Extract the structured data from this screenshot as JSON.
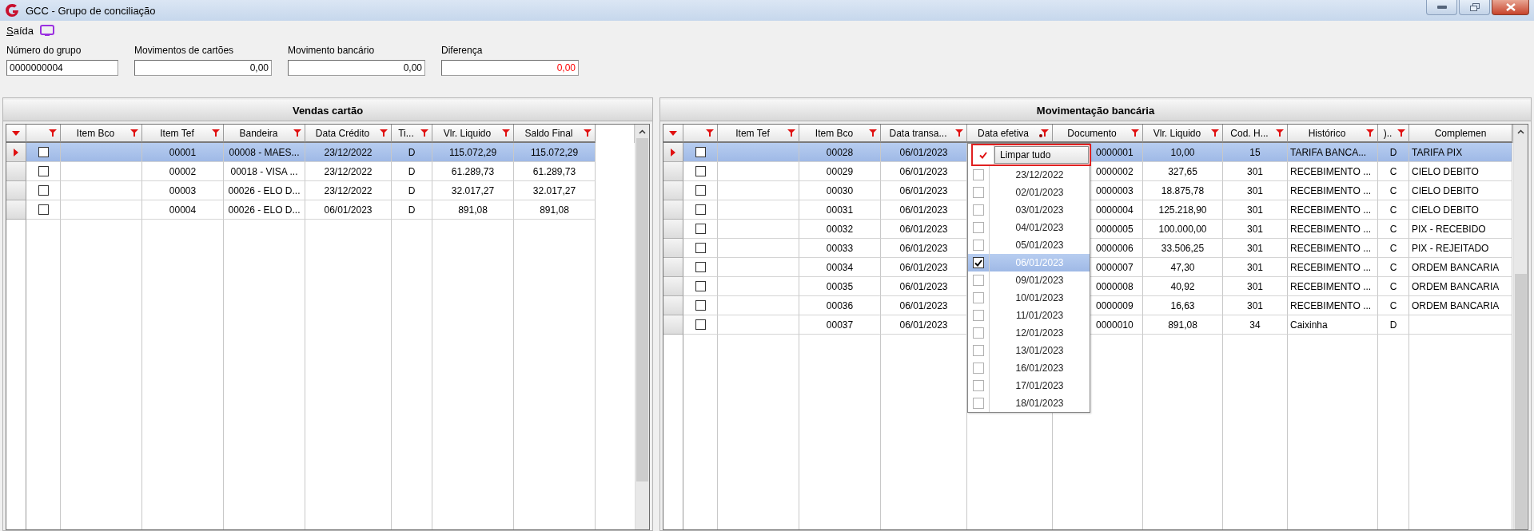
{
  "window": {
    "title": "GCC - Grupo de conciliação"
  },
  "menu": [
    {
      "label": "Saída"
    }
  ],
  "fields": [
    {
      "label": "Número do grupo",
      "value": "0000000004",
      "kind": "text",
      "alert": false
    },
    {
      "label": "Movimentos de cartões",
      "value": "0,00",
      "kind": "number",
      "alert": false
    },
    {
      "label": "Movimento bancário",
      "value": "0,00",
      "kind": "number",
      "alert": false
    },
    {
      "label": "Diferença",
      "value": "0,00",
      "kind": "number",
      "alert": true
    }
  ],
  "panels": [
    {
      "title": "Vendas cartão",
      "check_column": {
        "filter": true
      },
      "columns": [
        {
          "label": "Item Bco",
          "filter": true,
          "filter_active": false
        },
        {
          "label": "Item Tef",
          "filter": true,
          "filter_active": false
        },
        {
          "label": "Bandeira",
          "filter": true,
          "filter_active": false
        },
        {
          "label": "Data Crédito",
          "filter": true,
          "filter_active": false
        },
        {
          "label": "Ti...",
          "filter": true,
          "filter_active": false
        },
        {
          "label": "Vlr. Liquido",
          "filter": true,
          "filter_active": false
        },
        {
          "label": "Saldo Final",
          "filter": true,
          "filter_active": false
        }
      ],
      "rows": [
        {
          "selected": true,
          "checked": false,
          "cells": [
            null,
            "00001",
            "00008 - MAES...",
            "23/12/2022",
            "D",
            "115.072,29",
            "115.072,29"
          ]
        },
        {
          "selected": false,
          "checked": false,
          "cells": [
            null,
            "00002",
            "00018 - VISA ...",
            "23/12/2022",
            "D",
            "61.289,73",
            "61.289,73"
          ]
        },
        {
          "selected": false,
          "checked": false,
          "cells": [
            null,
            "00003",
            "00026 - ELO D...",
            "23/12/2022",
            "D",
            "32.017,27",
            "32.017,27"
          ]
        },
        {
          "selected": false,
          "checked": false,
          "cells": [
            null,
            "00004",
            "00026 - ELO D...",
            "06/01/2023",
            "D",
            "891,08",
            "891,08"
          ]
        }
      ]
    },
    {
      "title": "Movimentação bancária",
      "check_column": {
        "filter": true
      },
      "columns": [
        {
          "label": "Item Tef",
          "filter": true,
          "filter_active": false
        },
        {
          "label": "Item Bco",
          "filter": true,
          "filter_active": false
        },
        {
          "label": "Data transa...",
          "filter": true,
          "filter_active": false
        },
        {
          "label": "Data efetiva",
          "filter": true,
          "filter_active": true
        },
        {
          "label": "Documento",
          "filter": true,
          "filter_active": false
        },
        {
          "label": "Vlr. Liquido",
          "filter": true,
          "filter_active": false
        },
        {
          "label": "Cod. H...",
          "filter": true,
          "filter_active": false
        },
        {
          "label": "Histórico",
          "filter": true,
          "filter_active": false
        },
        {
          "label": ")..",
          "filter": true,
          "filter_active": false
        },
        {
          "label": "Complemen",
          "filter": false
        }
      ],
      "rows": [
        {
          "selected": true,
          "checked": false,
          "cells": [
            null,
            "00028",
            "06/01/2023",
            null,
            "0000001",
            "10,00",
            "15",
            "TARIFA BANCA...",
            "D",
            "TARIFA PIX"
          ]
        },
        {
          "selected": false,
          "checked": false,
          "cells": [
            null,
            "00029",
            "06/01/2023",
            null,
            "0000002",
            "327,65",
            "301",
            "RECEBIMENTO ...",
            "C",
            "CIELO DEBITO"
          ]
        },
        {
          "selected": false,
          "checked": false,
          "cells": [
            null,
            "00030",
            "06/01/2023",
            null,
            "0000003",
            "18.875,78",
            "301",
            "RECEBIMENTO ...",
            "C",
            "CIELO DEBITO"
          ]
        },
        {
          "selected": false,
          "checked": false,
          "cells": [
            null,
            "00031",
            "06/01/2023",
            null,
            "0000004",
            "125.218,90",
            "301",
            "RECEBIMENTO ...",
            "C",
            "CIELO DEBITO"
          ]
        },
        {
          "selected": false,
          "checked": false,
          "cells": [
            null,
            "00032",
            "06/01/2023",
            null,
            "0000005",
            "100.000,00",
            "301",
            "RECEBIMENTO ...",
            "C",
            "PIX - RECEBIDO"
          ]
        },
        {
          "selected": false,
          "checked": false,
          "cells": [
            null,
            "00033",
            "06/01/2023",
            null,
            "0000006",
            "33.506,25",
            "301",
            "RECEBIMENTO ...",
            "C",
            "PIX - REJEITADO"
          ]
        },
        {
          "selected": false,
          "checked": false,
          "cells": [
            null,
            "00034",
            "06/01/2023",
            null,
            "0000007",
            "47,30",
            "301",
            "RECEBIMENTO ...",
            "C",
            "ORDEM BANCARIA"
          ]
        },
        {
          "selected": false,
          "checked": false,
          "cells": [
            null,
            "00035",
            "06/01/2023",
            null,
            "0000008",
            "40,92",
            "301",
            "RECEBIMENTO ...",
            "C",
            "ORDEM BANCARIA"
          ]
        },
        {
          "selected": false,
          "checked": false,
          "cells": [
            null,
            "00036",
            "06/01/2023",
            null,
            "0000009",
            "16,63",
            "301",
            "RECEBIMENTO ...",
            "C",
            "ORDEM BANCARIA"
          ]
        },
        {
          "selected": false,
          "checked": false,
          "cells": [
            null,
            "00037",
            "06/01/2023",
            null,
            "0000010",
            "891,08",
            "34",
            "Caixinha",
            "D",
            null
          ]
        }
      ],
      "filter_dropdown": {
        "items": [
          {
            "kind": "action",
            "label": "Limpar tudo",
            "checked": true,
            "framed": true
          },
          {
            "kind": "option",
            "label": "23/12/2022",
            "checked": false,
            "selected": false
          },
          {
            "kind": "option",
            "label": "02/01/2023",
            "checked": false,
            "selected": false
          },
          {
            "kind": "option",
            "label": "03/01/2023",
            "checked": false,
            "selected": false
          },
          {
            "kind": "option",
            "label": "04/01/2023",
            "checked": false,
            "selected": false
          },
          {
            "kind": "option",
            "label": "05/01/2023",
            "checked": false,
            "selected": false
          },
          {
            "kind": "option",
            "label": "06/01/2023",
            "checked": true,
            "selected": true
          },
          {
            "kind": "option",
            "label": "09/01/2023",
            "checked": false,
            "selected": false
          },
          {
            "kind": "option",
            "label": "10/01/2023",
            "checked": false,
            "selected": false
          },
          {
            "kind": "option",
            "label": "11/01/2023",
            "checked": false,
            "selected": false
          },
          {
            "kind": "option",
            "label": "12/01/2023",
            "checked": false,
            "selected": false
          },
          {
            "kind": "option",
            "label": "13/01/2023",
            "checked": false,
            "selected": false
          },
          {
            "kind": "option",
            "label": "16/01/2023",
            "checked": false,
            "selected": false
          },
          {
            "kind": "option",
            "label": "17/01/2023",
            "checked": false,
            "selected": false
          },
          {
            "kind": "option",
            "label": "18/01/2023",
            "checked": false,
            "selected": false
          }
        ]
      }
    }
  ]
}
